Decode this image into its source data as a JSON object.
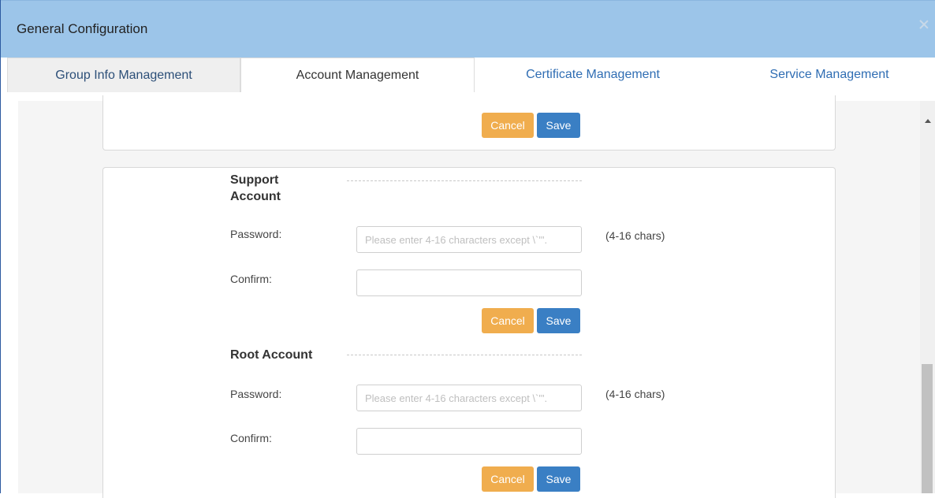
{
  "dialog": {
    "title": "General Configuration"
  },
  "tabs": [
    {
      "label": "Group Info Management"
    },
    {
      "label": "Account Management"
    },
    {
      "label": "Certificate Management"
    },
    {
      "label": "Service Management"
    }
  ],
  "top_section": {
    "cancel_label": "Cancel",
    "save_label": "Save"
  },
  "support_account": {
    "title_line1": "Support",
    "title_line2": "Account",
    "password_label": "Password:",
    "password_placeholder": "Please enter 4-16 characters except \\`'\".",
    "password_hint": "(4-16 chars)",
    "confirm_label": "Confirm:",
    "confirm_value": "",
    "cancel_label": "Cancel",
    "save_label": "Save"
  },
  "root_account": {
    "title": "Root Account",
    "password_label": "Password:",
    "password_placeholder": "Please enter 4-16 characters except \\`'\".",
    "password_hint": "(4-16 chars)",
    "confirm_label": "Confirm:",
    "confirm_value": "",
    "cancel_label": "Cancel",
    "save_label": "Save"
  },
  "colors": {
    "titlebar": "#9cc5e9",
    "cancel_button": "#f0ad4e",
    "save_button": "#3a7fc4",
    "tab_link": "#2f6db3"
  },
  "icons": {
    "close": "close-icon",
    "scroll_up": "scroll-up-arrow-icon"
  }
}
